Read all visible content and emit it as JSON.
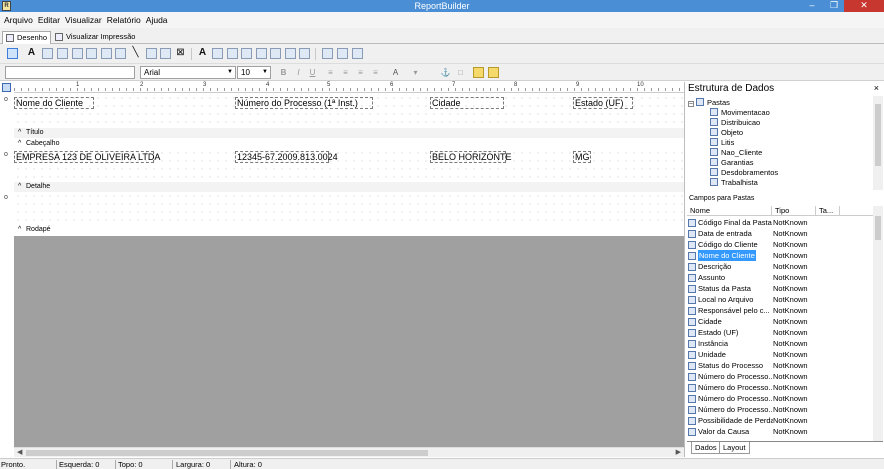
{
  "window": {
    "title": "ReportBuilder",
    "app_icon_letter": "R"
  },
  "menu": [
    "Arquivo",
    "Editar",
    "Visualizar",
    "Relatório",
    "Ajuda"
  ],
  "doc_tabs": [
    {
      "label": "Desenho",
      "active": true
    },
    {
      "label": "Visualizar Impressão",
      "active": false
    }
  ],
  "format_toolbar": {
    "style_value": "",
    "font_value": "Arial",
    "size_value": "10"
  },
  "ruler_numbers": [
    "1",
    "2",
    "3",
    "4",
    "5",
    "6",
    "7",
    "8",
    "9",
    "10"
  ],
  "bands": {
    "header_fields": [
      "Nome do Cliente",
      "Número do Processo (1ª Inst.)",
      "Cidade",
      "Estado (UF)"
    ],
    "title_label": "Título",
    "header_label": "Cabeçalho",
    "detail_fields": [
      "EMPRESA 123 DE OLIVEIRA LTDA",
      "12345-67.2009.813.0024",
      "BELO HORIZONTE",
      "MG"
    ],
    "detail_label": "Detalhe",
    "footer_label": "Rodapé"
  },
  "data_panel": {
    "title": "Estrutura de Dados",
    "close": "×",
    "tree_root": "Pastas",
    "tree_items": [
      "Movimentacao",
      "Distribuicao",
      "Objeto",
      "Litis",
      "Nao_Cliente",
      "Garantias",
      "Desdobramentos",
      "Trabalhista"
    ],
    "fields_label": "Campos para Pastas",
    "columns": [
      "Nome",
      "Tipo",
      "Ta..."
    ],
    "fields": [
      {
        "name": "Código Final da Pasta",
        "type": "NotKnown"
      },
      {
        "name": "Data de entrada",
        "type": "NotKnown"
      },
      {
        "name": "Código do Cliente",
        "type": "NotKnown"
      },
      {
        "name": "Nome do Cliente",
        "type": "NotKnown",
        "selected": true
      },
      {
        "name": "Descrição",
        "type": "NotKnown"
      },
      {
        "name": "Assunto",
        "type": "NotKnown"
      },
      {
        "name": "Status da Pasta",
        "type": "NotKnown"
      },
      {
        "name": "Local no Arquivo",
        "type": "NotKnown"
      },
      {
        "name": "Responsável pelo c...",
        "type": "NotKnown"
      },
      {
        "name": "Cidade",
        "type": "NotKnown"
      },
      {
        "name": "Estado (UF)",
        "type": "NotKnown"
      },
      {
        "name": "Instância",
        "type": "NotKnown"
      },
      {
        "name": "Unidade",
        "type": "NotKnown"
      },
      {
        "name": "Status do Processo",
        "type": "NotKnown"
      },
      {
        "name": "Número do Processo...",
        "type": "NotKnown"
      },
      {
        "name": "Número do Processo...",
        "type": "NotKnown"
      },
      {
        "name": "Número do Processo...",
        "type": "NotKnown"
      },
      {
        "name": "Número do Processo...",
        "type": "NotKnown"
      },
      {
        "name": "Possibilidade de Perda",
        "type": "NotKnown"
      },
      {
        "name": "Valor da Causa",
        "type": "NotKnown"
      }
    ],
    "bottom_tabs": [
      "Dados",
      "Layout"
    ]
  },
  "status": {
    "text": "Pronto.",
    "left": "Esquerda: 0",
    "top": "Topo: 0",
    "width": "Largura: 0",
    "height": "Altura: 0"
  },
  "colors": {
    "titlebar": "#4a8fd6",
    "close_button": "#c7372f",
    "selection": "#3399ff",
    "workspace": "#a0a0a0"
  }
}
